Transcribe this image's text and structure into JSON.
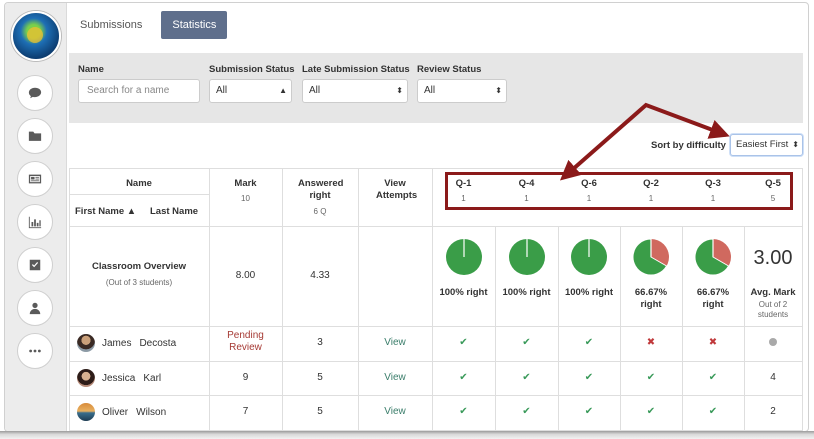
{
  "tabs": [
    {
      "label": "Submissions",
      "active": false
    },
    {
      "label": "Statistics",
      "active": true
    }
  ],
  "sidebar": {
    "icons": [
      "chat-icon",
      "folder-icon",
      "newspaper-icon",
      "bar-chart-icon",
      "checkbox-icon",
      "user-icon",
      "more-icon"
    ]
  },
  "filters": {
    "name_label": "Name",
    "name_placeholder": "Search for a name",
    "submission_status_label": "Submission Status",
    "submission_status_value": "All",
    "late_status_label": "Late Submission Status",
    "late_status_value": "All",
    "review_status_label": "Review Status",
    "review_status_value": "All"
  },
  "sort": {
    "label": "Sort by difficulty",
    "value": "Easiest First"
  },
  "table": {
    "headers": {
      "name": "Name",
      "first_name": "First Name ▲",
      "last_name": "Last Name",
      "mark": "Mark",
      "mark_sub": "10",
      "answered": "Answered right",
      "answered_sub": "6 Q",
      "view": "View Attempts"
    },
    "questions": [
      {
        "label": "Q-1",
        "weight": "1",
        "pct_right": 100,
        "pie_label": "100% right"
      },
      {
        "label": "Q-4",
        "weight": "1",
        "pct_right": 100,
        "pie_label": "100% right"
      },
      {
        "label": "Q-6",
        "weight": "1",
        "pct_right": 100,
        "pie_label": "100% right"
      },
      {
        "label": "Q-2",
        "weight": "1",
        "pct_right": 66.67,
        "pie_label": "66.67% right"
      },
      {
        "label": "Q-3",
        "weight": "1",
        "pct_right": 66.67,
        "pie_label": "66.67% right"
      },
      {
        "label": "Q-5",
        "weight": "5",
        "big": "3.00",
        "pie_label": "Avg. Mark",
        "sub1": "Out of 2",
        "sub2": "students"
      }
    ],
    "overview": {
      "title": "Classroom Overview",
      "subtitle": "(Out of 3 students)",
      "mark": "8.00",
      "answered": "4.33"
    },
    "students": [
      {
        "first": "James",
        "last": "Decosta",
        "mark": "Pending Review",
        "answered": "3",
        "view": "View",
        "results": [
          "check",
          "check",
          "check",
          "cross",
          "cross",
          "dot"
        ]
      },
      {
        "first": "Jessica",
        "last": "Karl",
        "mark": "9",
        "answered": "5",
        "view": "View",
        "results": [
          "check",
          "check",
          "check",
          "check",
          "check",
          "4"
        ]
      },
      {
        "first": "Oliver",
        "last": "Wilson",
        "mark": "7",
        "answered": "5",
        "view": "View",
        "results": [
          "check",
          "check",
          "check",
          "check",
          "check",
          "2"
        ]
      }
    ]
  },
  "colors": {
    "pie_green": "#3a9d48",
    "pie_red": "#d0695f",
    "highlight": "#8b1a1a",
    "tab_active": "#5f6f8c"
  }
}
